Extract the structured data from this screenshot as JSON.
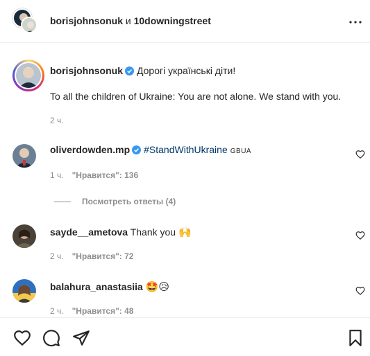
{
  "header": {
    "user1": "borisjohnsonuk",
    "connector": "и",
    "user2": "10downingstreet",
    "more_icon": "more-horizontal-icon"
  },
  "post": {
    "username": "borisjohnsonuk",
    "text_ua": "Дорогі українські діти!",
    "text_en": "To all the children of Ukraine: You are not alone. We stand with you.",
    "time": "2 ч."
  },
  "comments": [
    {
      "username": "oliverdowden.mp",
      "hashtag": "#StandWithUkraine",
      "flag_text": "GBUA",
      "time": "1 ч.",
      "likes": "\"Нравится\": 136",
      "replies": "Посмотреть ответы (4)"
    },
    {
      "username": "sayde__ametova",
      "text": "Thank you",
      "emoji": "🙌",
      "time": "2 ч.",
      "likes": "\"Нравится\": 72"
    },
    {
      "username": "balahura_anastasiia",
      "emoji": "🤩😥",
      "time": "2 ч.",
      "likes": "\"Нравится\": 48"
    }
  ],
  "actions": {
    "like_icon": "heart-icon",
    "comment_icon": "comment-icon",
    "share_icon": "share-icon",
    "save_icon": "bookmark-icon"
  },
  "colors": {
    "verified": "#3897f0",
    "hashtag": "#00376b",
    "muted": "#8e8e8e",
    "border": "#efefef"
  }
}
